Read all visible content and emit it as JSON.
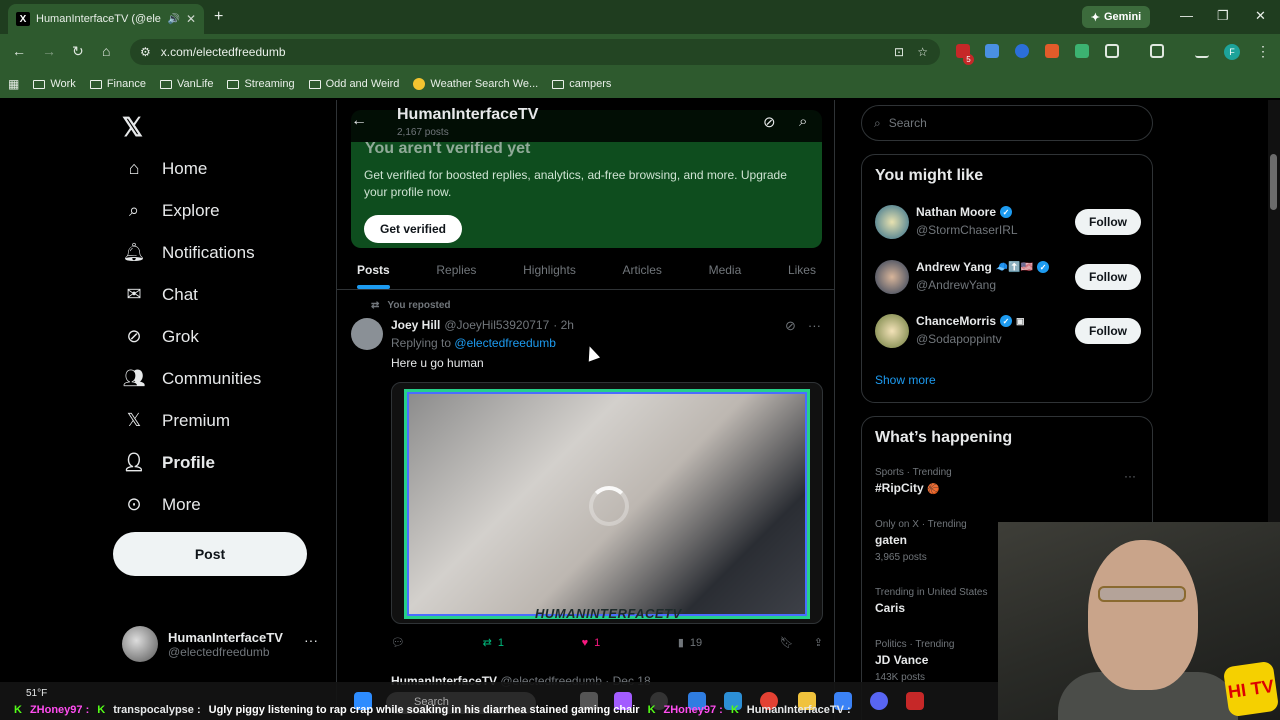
{
  "browser": {
    "tab_title": "HumanInterfaceTV (@electe",
    "url": "x.com/electedfreedumb",
    "gemini_label": "Gemini",
    "profile_initial": "F",
    "extension_badge": "5",
    "bookmarks": [
      {
        "label": "Work",
        "icon": "folder-icon"
      },
      {
        "label": "Finance",
        "icon": "folder-icon"
      },
      {
        "label": "VanLife",
        "icon": "folder-icon"
      },
      {
        "label": "Streaming",
        "icon": "folder-icon"
      },
      {
        "label": "Odd and Weird",
        "icon": "folder-icon"
      },
      {
        "label": "Weather Search We...",
        "icon": "weather-icon"
      },
      {
        "label": "campers",
        "icon": "folder-icon"
      }
    ]
  },
  "nav": {
    "items": [
      {
        "label": "Home",
        "icon": "home-icon"
      },
      {
        "label": "Explore",
        "icon": "search-icon"
      },
      {
        "label": "Notifications",
        "icon": "bell-icon"
      },
      {
        "label": "Chat",
        "icon": "mail-icon"
      },
      {
        "label": "Grok",
        "icon": "grok-icon"
      },
      {
        "label": "Communities",
        "icon": "communities-icon"
      },
      {
        "label": "Premium",
        "icon": "x-icon"
      },
      {
        "label": "Profile",
        "icon": "person-icon"
      },
      {
        "label": "More",
        "icon": "more-circle-icon"
      }
    ],
    "post_label": "Post",
    "account": {
      "name": "HumanInterfaceTV",
      "handle": "@electedfreedumb"
    }
  },
  "profile": {
    "name": "HumanInterfaceTV",
    "post_count": "2,167 posts",
    "verify_title": "You aren't verified yet",
    "verify_desc": "Get verified for boosted replies, analytics, ad-free browsing, and more. Upgrade your profile now.",
    "get_verified_label": "Get verified",
    "tabs": [
      "Posts",
      "Replies",
      "Highlights",
      "Articles",
      "Media",
      "Likes"
    ],
    "active_tab": "Posts"
  },
  "tweet": {
    "repost_label": "You reposted",
    "author": "Joey Hill",
    "handle": "@JoeyHil53920717",
    "time": "· 2h",
    "replying_prefix": "Replying to",
    "replying_to": "@electedfreedumb",
    "text": "Here u go human",
    "video_watermark": "HUMANINTERFACETV",
    "reposts": "1",
    "likes": "1",
    "views": "19"
  },
  "next_tweet": {
    "author": "HumanInterfaceTV",
    "handle": "@electedfreedumb · Dec 18"
  },
  "right": {
    "search_placeholder": "Search",
    "might_like_title": "You might like",
    "suggestions": [
      {
        "name": "Nathan Moore",
        "handle": "@StormChaserIRL",
        "emoji": "",
        "follow": "Follow"
      },
      {
        "name": "Andrew Yang",
        "handle": "@AndrewYang",
        "emoji": "🧢⬆️🇺🇸",
        "follow": "Follow"
      },
      {
        "name": "ChanceMorris",
        "handle": "@Sodapoppintv",
        "emoji": "",
        "follow": "Follow"
      }
    ],
    "show_more": "Show more",
    "happening_title": "What’s happening",
    "trends": [
      {
        "meta": "Sports · Trending",
        "name": "#RipCity",
        "count": ""
      },
      {
        "meta": "Only on X · Trending",
        "name": "gaten",
        "count": "3,965 posts"
      },
      {
        "meta": "Trending in United States",
        "name": "Caris",
        "count": ""
      },
      {
        "meta": "Politics · Trending",
        "name": "JD Vance",
        "count": "143K posts"
      }
    ]
  },
  "taskbar": {
    "weather": "51°F",
    "search": "Search"
  },
  "ticker": [
    {
      "user": "ZHoney97 :",
      "msg": ""
    },
    {
      "user": "transpocalypse :",
      "msg": "Ugly piggy listening to rap crap while soaking in his diarrhea stained gaming chair"
    },
    {
      "user": "ZHoney97 :",
      "msg": ""
    },
    {
      "user": "HumanInterfaceTV :",
      "msg": ""
    }
  ],
  "overlay": {
    "logo_text": "HI TV"
  }
}
